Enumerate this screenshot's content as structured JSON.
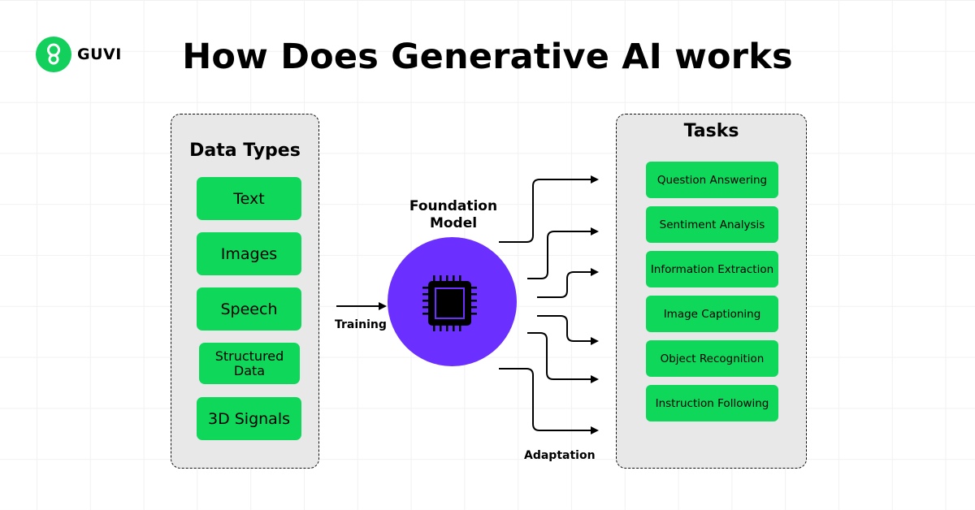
{
  "brand": {
    "name": "GUVI",
    "logo_icon": "guvi-logo-icon",
    "accent_color": "#13cf5b"
  },
  "title": "How Does Generative AI works",
  "colors": {
    "box_green": "#0fd75a",
    "model_purple": "#6b2fff",
    "panel_gray": "#e8e8e8"
  },
  "data_types": {
    "heading": "Data Types",
    "items": [
      {
        "label": "Text"
      },
      {
        "label": "Images"
      },
      {
        "label": "Speech"
      },
      {
        "label_line1": "Structured",
        "label_line2": "Data"
      },
      {
        "label": "3D Signals"
      }
    ]
  },
  "model": {
    "label_line1": "Foundation",
    "label_line2": "Model",
    "icon": "cpu-chip-icon"
  },
  "edges": {
    "training": "Training",
    "adaptation": "Adaptation"
  },
  "tasks": {
    "heading": "Tasks",
    "items": [
      {
        "label": "Question Answering"
      },
      {
        "label": "Sentiment Analysis"
      },
      {
        "label": "Information Extraction"
      },
      {
        "label": "Image Captioning"
      },
      {
        "label": "Object Recognition"
      },
      {
        "label": "Instruction Following"
      }
    ]
  }
}
